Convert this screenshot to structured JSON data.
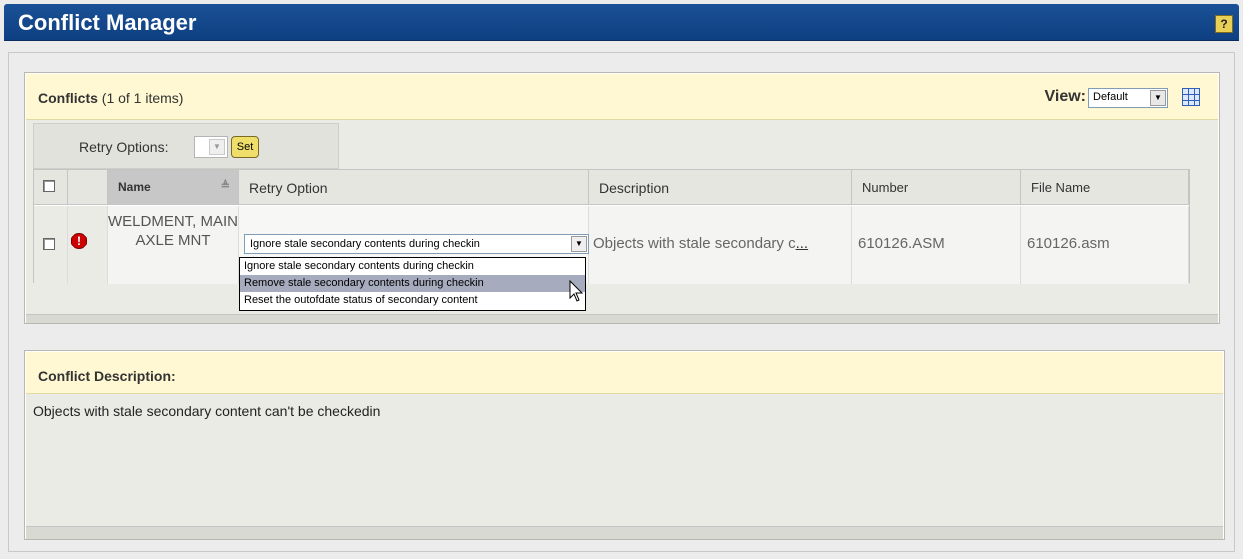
{
  "window": {
    "title": "Conflict Manager",
    "help_label": "?"
  },
  "conflicts_panel": {
    "title_bold": "Conflicts",
    "title_count": "(1 of 1 items)",
    "view_label": "View:",
    "view_value": "Default"
  },
  "retry_options": {
    "label": "Retry Options:",
    "set_label": "Set"
  },
  "table": {
    "columns": [
      "Name",
      "Retry Option",
      "Description",
      "Number",
      "File Name"
    ],
    "rows": [
      {
        "name": "WELDMENT, MAIN AXLE MNT",
        "retry_option": "Ignore stale secondary contents during checkin",
        "description": "Objects with stale secondary c...",
        "number": "610126.ASM",
        "file_name": "610126.asm"
      }
    ]
  },
  "retry_dropdown": {
    "options": [
      "Ignore stale secondary contents during checkin",
      "Remove stale secondary contents during checkin",
      "Reset the outofdate status of secondary content"
    ],
    "highlighted_index": 1
  },
  "description_panel": {
    "title": "Conflict Description:",
    "text": "Objects with stale secondary content can't be checkedin"
  },
  "icons": {
    "help": "help-icon",
    "error": "error-icon",
    "grid": "table-view-icon",
    "sort": "sort-ascending-icon",
    "cursor": "mouse-cursor-icon"
  },
  "colors": {
    "title_bar": "#0e3f82",
    "panel_header": "#fff8d2",
    "error": "#cc0000",
    "set_button": "#f0de6b"
  }
}
